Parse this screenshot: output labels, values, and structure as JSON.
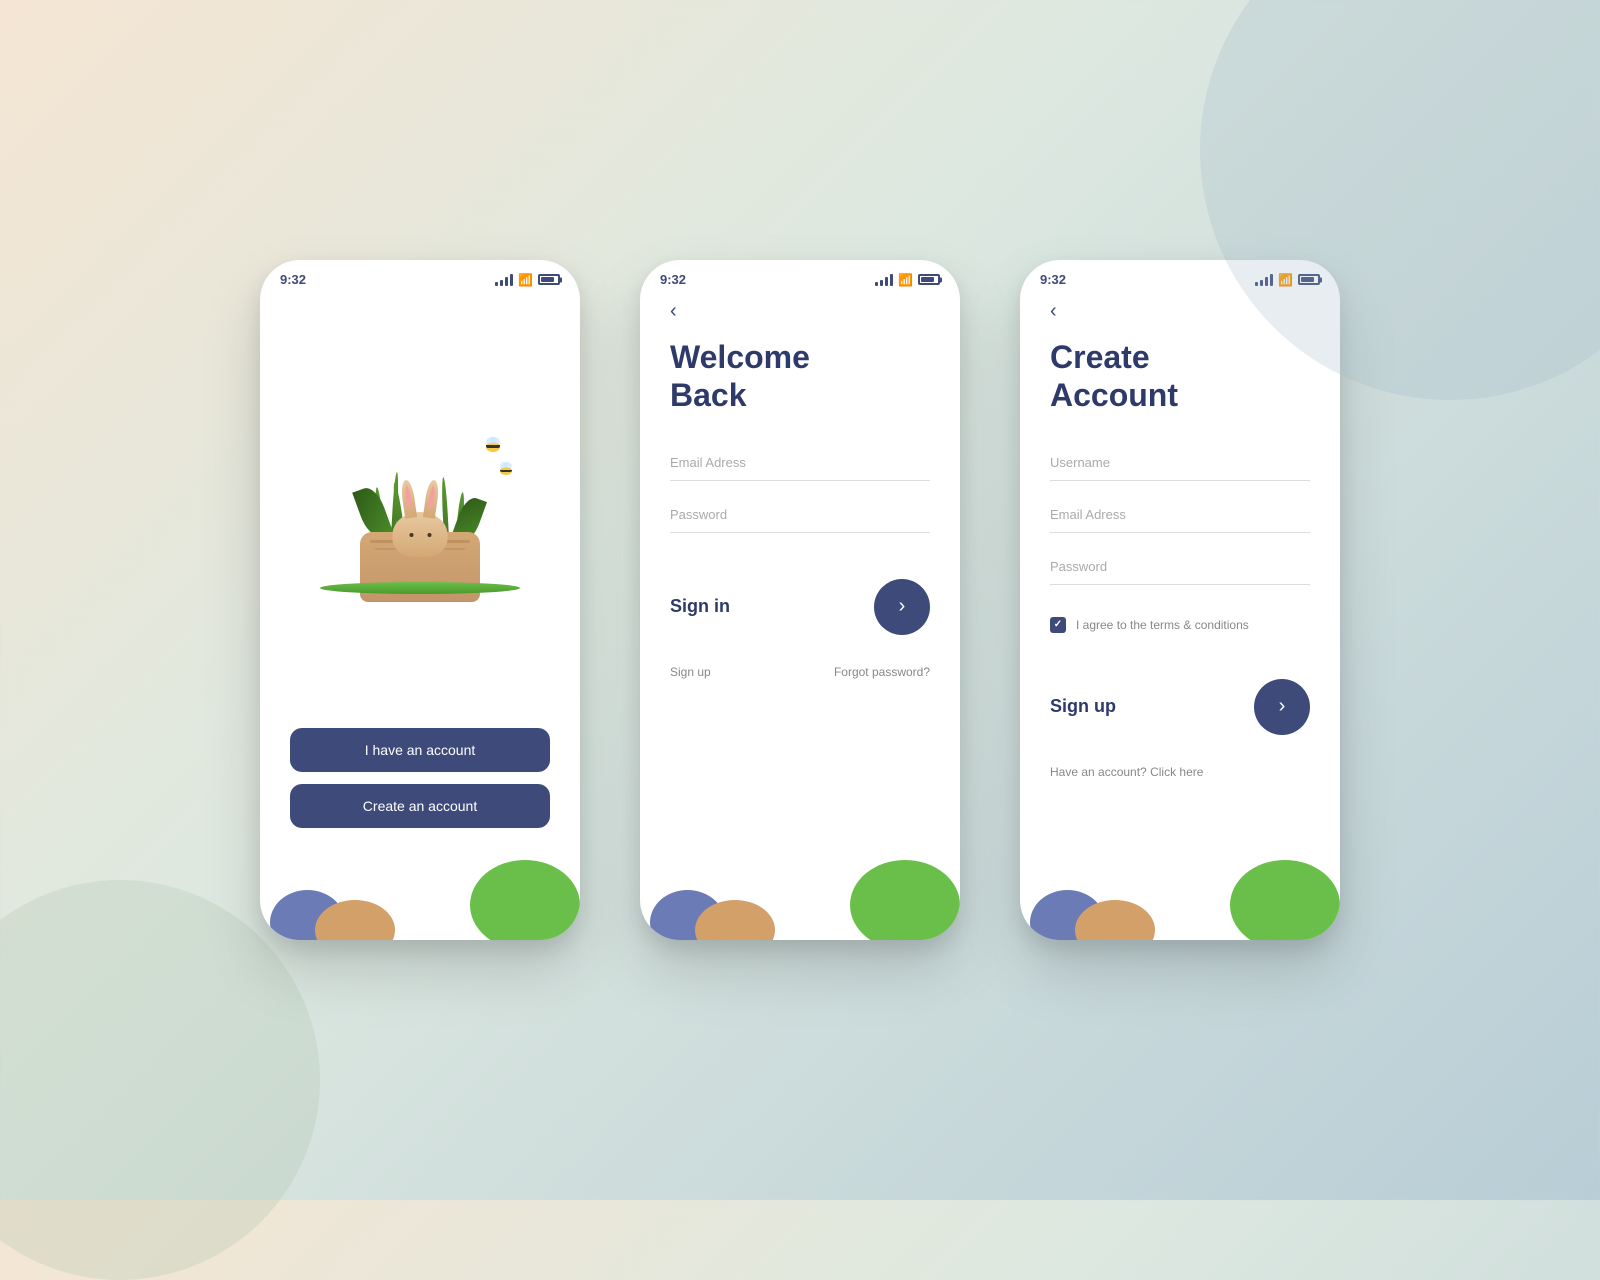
{
  "background": {
    "colors": [
      "#f5e6d3",
      "#dde8e0",
      "#b8cdd6"
    ]
  },
  "phones": [
    {
      "id": "phone1",
      "statusBar": {
        "time": "9:32",
        "signal": true,
        "wifi": true,
        "battery": true
      },
      "buttons": [
        {
          "label": "I have an account",
          "type": "primary"
        },
        {
          "label": "Create an account",
          "type": "primary"
        }
      ]
    },
    {
      "id": "phone2",
      "statusBar": {
        "time": "9:32"
      },
      "backButton": "<",
      "title": "Welcome\nBack",
      "titleLine1": "Welcome",
      "titleLine2": "Back",
      "fields": [
        {
          "placeholder": "Email Adress"
        },
        {
          "placeholder": "Password"
        }
      ],
      "actionLabel": "Sign in",
      "actionButton": ">",
      "bottomLinks": [
        {
          "label": "Sign up"
        },
        {
          "label": "Forgot password?"
        }
      ]
    },
    {
      "id": "phone3",
      "statusBar": {
        "time": "9:32"
      },
      "backButton": "<",
      "title": "Create\nAccount",
      "titleLine1": "Create",
      "titleLine2": "Account",
      "fields": [
        {
          "placeholder": "Username"
        },
        {
          "placeholder": "Email Adress"
        },
        {
          "placeholder": "Password"
        }
      ],
      "checkbox": {
        "checked": true,
        "label": "I agree to the terms & conditions"
      },
      "actionLabel": "Sign up",
      "actionButton": ">",
      "bottomLink": "Have an account? Click here"
    }
  ],
  "blobs": {
    "blue": "#6b7bb5",
    "orange": "#d4a06a",
    "green": "#6abf4b"
  }
}
